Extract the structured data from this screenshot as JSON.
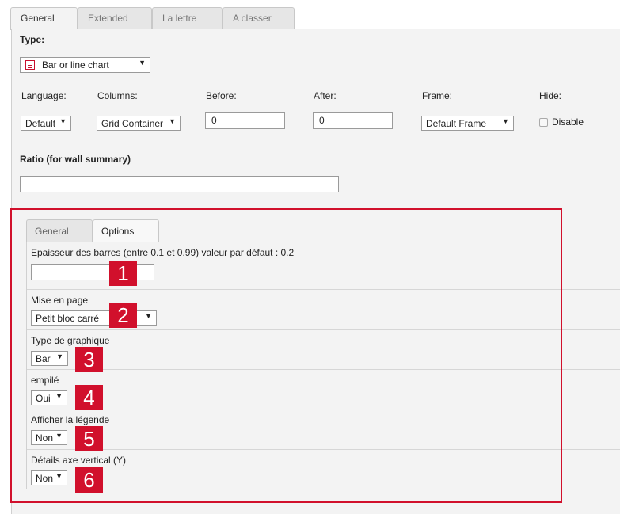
{
  "top_tabs": [
    "General",
    "Extended",
    "La lettre",
    "A classer"
  ],
  "type_label": "Type:",
  "type_select": "Bar or line chart",
  "fields": {
    "language_label": "Language:",
    "language_value": "Default",
    "columns_label": "Columns:",
    "columns_value": "Grid Container",
    "before_label": "Before:",
    "before_value": "0",
    "after_label": "After:",
    "after_value": "0",
    "frame_label": "Frame:",
    "frame_value": "Default Frame",
    "hide_label": "Hide:",
    "disable_label": "Disable"
  },
  "ratio_label": "Ratio (for wall summary)",
  "ratio_value": "",
  "inner_tabs": [
    "General",
    "Options"
  ],
  "options": {
    "bar_thickness_label": "Epaisseur des barres (entre 0.1 et 0.99) valeur par défaut : 0.2",
    "bar_thickness_value": "",
    "layout_label": "Mise en page",
    "layout_value": "Petit bloc carré",
    "chart_type_label": "Type de graphique",
    "chart_type_value": "Bar",
    "stacked_label": "empilé",
    "stacked_value": "Oui",
    "legend_label": "Afficher la légende",
    "legend_value": "Non",
    "y_axis_label": "Détails axe vertical (Y)",
    "y_axis_value": "Non"
  },
  "badges": [
    "1",
    "2",
    "3",
    "4",
    "5",
    "6"
  ],
  "colors": {
    "highlight": "#d1102c",
    "panel": "#f3f3f3"
  }
}
